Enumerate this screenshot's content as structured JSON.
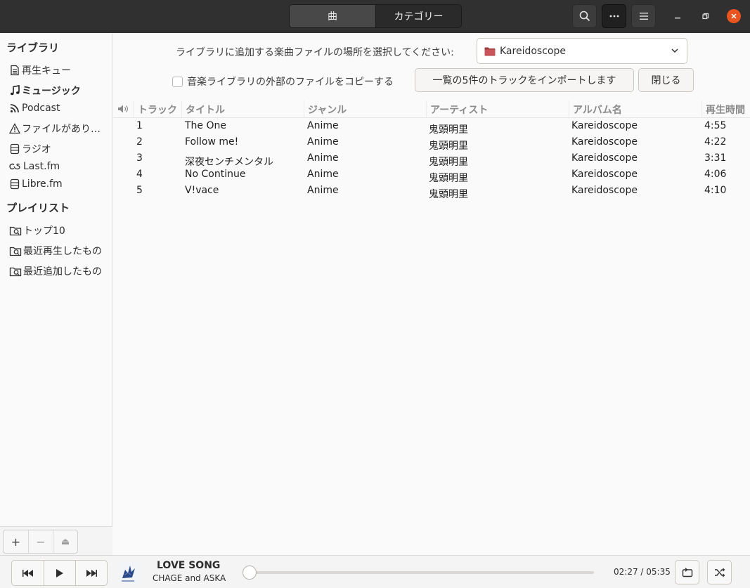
{
  "header": {
    "tabs": [
      {
        "label": "曲",
        "active": true
      },
      {
        "label": "カテゴリー",
        "active": false
      }
    ],
    "buttons": {
      "search_icon": "search-icon",
      "more_icon": "more-horizontal-icon",
      "menu_icon": "hamburger-menu-icon"
    },
    "window": {
      "minimize_icon": "minimize-icon",
      "restore_icon": "restore-icon",
      "close_icon": "close-icon"
    }
  },
  "sidebar": {
    "library_heading": "ライブラリ",
    "library_items": [
      {
        "label": "再生キュー",
        "icon": "document-icon"
      },
      {
        "label": "ミュージック",
        "icon": "music-note-icon",
        "selected": true
      },
      {
        "label": "Podcast",
        "icon": "rss-icon"
      },
      {
        "label": "ファイルがあり…",
        "icon": "warning-icon"
      },
      {
        "label": "ラジオ",
        "icon": "radio-icon"
      },
      {
        "label": "Last.fm",
        "icon": "lastfm-icon"
      },
      {
        "label": "Libre.fm",
        "icon": "radio-icon"
      }
    ],
    "playlist_heading": "プレイリスト",
    "playlist_items": [
      {
        "label": "トップ10",
        "icon": "smart-playlist-icon"
      },
      {
        "label": "最近再生したもの",
        "icon": "smart-playlist-icon"
      },
      {
        "label": "最近追加したもの",
        "icon": "smart-playlist-icon"
      }
    ],
    "tools": {
      "add": "+",
      "remove": "−",
      "eject": "⏏"
    }
  },
  "import_bar": {
    "location_label": "ライブラリに追加する楽曲ファイルの場所を選択してください:",
    "folder": "Kareidoscope",
    "copy_label": "音楽ライブラリの外部のファイルをコピーする",
    "copy_checked": false,
    "import_button": "一覧の5件のトラックをインポートします",
    "close_button": "閉じる"
  },
  "table": {
    "columns": [
      "トラック",
      "タイトル",
      "ジャンル",
      "アーティスト",
      "アルバム名",
      "再生時間"
    ],
    "rows": [
      {
        "track": "1",
        "title": "The One",
        "genre": "Anime",
        "artist": "鬼頭明里",
        "album": "Kareidoscope",
        "time": "4:55"
      },
      {
        "track": "2",
        "title": "Follow me!",
        "genre": "Anime",
        "artist": "鬼頭明里",
        "album": "Kareidoscope",
        "time": "4:22"
      },
      {
        "track": "3",
        "title": "深夜センチメンタル",
        "genre": "Anime",
        "artist": "鬼頭明里",
        "album": "Kareidoscope",
        "time": "3:31"
      },
      {
        "track": "4",
        "title": "No Continue",
        "genre": "Anime",
        "artist": "鬼頭明里",
        "album": "Kareidoscope",
        "time": "4:06"
      },
      {
        "track": "5",
        "title": "V!vace",
        "genre": "Anime",
        "artist": "鬼頭明里",
        "album": "Kareidoscope",
        "time": "4:10"
      }
    ]
  },
  "player": {
    "title": "LOVE SONG",
    "artist": "CHAGE and ASKA",
    "position_fraction": 0.0,
    "time": "02:27 / 05:35"
  },
  "colors": {
    "accent": "#e95420",
    "headerbar": "#303030",
    "sidebar": "#fafafa"
  }
}
